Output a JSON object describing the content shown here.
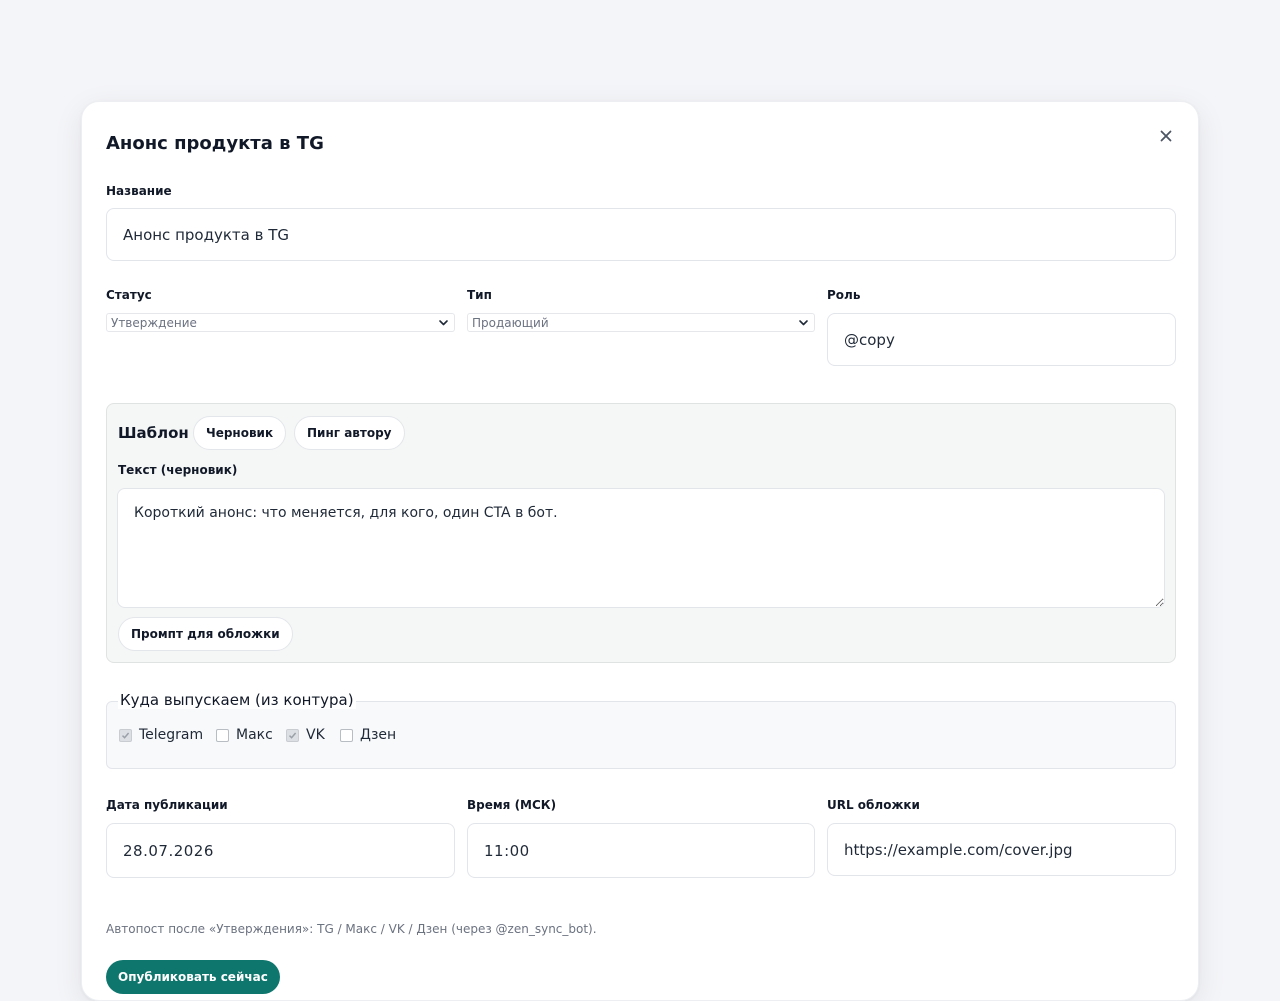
{
  "modal": {
    "title": "Анонс продукта в TG",
    "close_icon": "close-icon"
  },
  "name_field": {
    "label": "Название",
    "value": "Анонс продукта в TG"
  },
  "status_field": {
    "label": "Статус",
    "selected": "Утверждение"
  },
  "type_field": {
    "label": "Тип",
    "selected": "Продающий"
  },
  "role_field": {
    "label": "Роль",
    "value": "@copy"
  },
  "template": {
    "heading": "Шаблон",
    "draft_button": "Черновик",
    "ping_button": "Пинг автору",
    "text_label": "Текст (черновик)",
    "text_value": "Короткий анонс: что меняется, для кого, один CTA в бот.",
    "cover_prompt_button": "Промпт для обложки"
  },
  "channels": {
    "legend": "Куда выпускаем (из контура)",
    "items": [
      {
        "label": "Telegram",
        "checked": true
      },
      {
        "label": "Макс",
        "checked": false
      },
      {
        "label": "VK",
        "checked": true
      },
      {
        "label": "Дзен",
        "checked": false
      }
    ]
  },
  "date_field": {
    "label": "Дата публикации",
    "value": "28.07.2026"
  },
  "time_field": {
    "label": "Время (МСК)",
    "value": "11:00"
  },
  "cover_url_field": {
    "label": "URL обложки",
    "value": "https://example.com/cover.jpg"
  },
  "hint": "Автопост после «Утверждения»: TG / Макс / VK / Дзен (через @zen_sync_bot).",
  "publish_button": "Опубликовать сейчас",
  "colors": {
    "page_bg": "#f4f5f8",
    "accent": "#0f766e",
    "template_bg": "#f5f7f6"
  }
}
